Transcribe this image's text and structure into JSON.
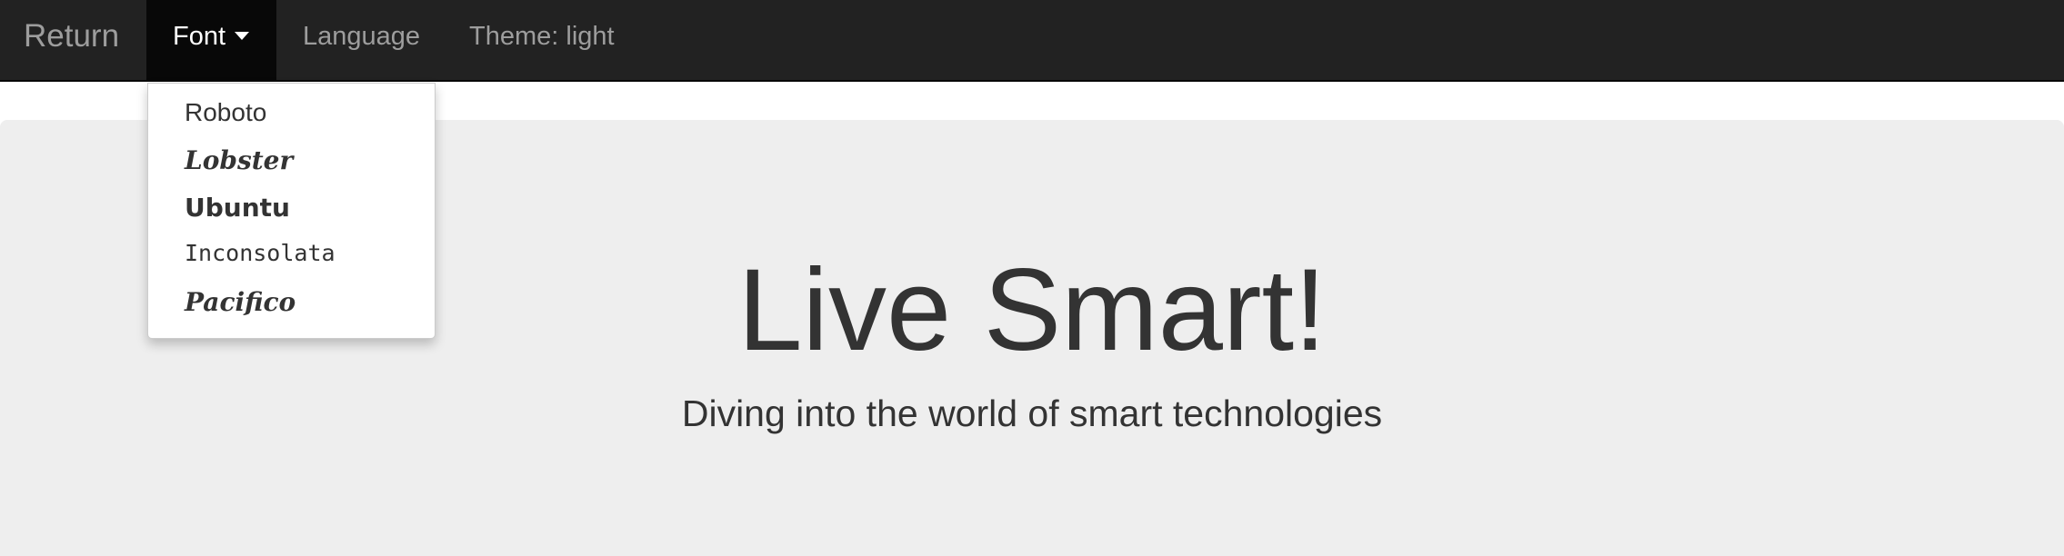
{
  "navbar": {
    "brand": "Return",
    "items": [
      {
        "label": "Font",
        "active": true
      },
      {
        "label": "Language"
      },
      {
        "label": "Theme: light"
      }
    ]
  },
  "font_menu": {
    "options": [
      "Roboto",
      "Lobster",
      "Ubuntu",
      "Inconsolata",
      "Pacifico"
    ]
  },
  "hero": {
    "title": "Live Smart!",
    "subtitle": "Diving into the world of smart technologies"
  },
  "colors": {
    "navbar_bg": "#222222",
    "active_nav_bg": "#080808",
    "nav_text": "#9d9d9d",
    "jumbotron_bg": "#eeeeee",
    "text": "#333333"
  },
  "icons": {
    "dropdown_caret": "caret-down-icon"
  }
}
